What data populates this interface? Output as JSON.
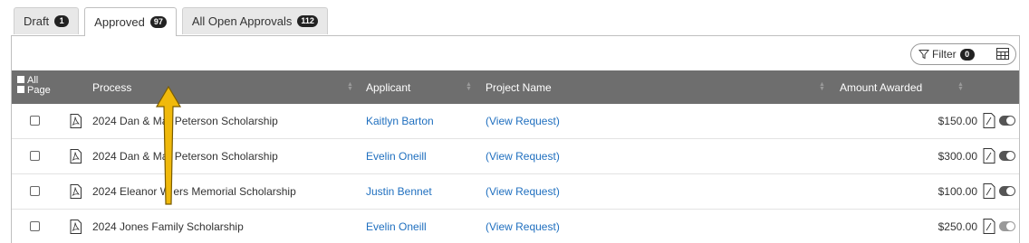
{
  "tabs": [
    {
      "label": "Draft",
      "count": "1"
    },
    {
      "label": "Approved",
      "count": "97"
    },
    {
      "label": "All Open Approvals",
      "count": "112"
    }
  ],
  "toolbar": {
    "filter_label": "Filter",
    "filter_count": "0"
  },
  "table": {
    "header": {
      "all": "All",
      "page": "Page",
      "process": "Process",
      "applicant": "Applicant",
      "project": "Project Name",
      "amount": "Amount Awarded"
    },
    "rows": [
      {
        "process": "2024 Dan & Mar  Peterson Scholarship",
        "applicant": "Kaitlyn Barton",
        "project": "(View Request)",
        "amount": "$150.00",
        "toggle": "on"
      },
      {
        "process": "2024 Dan & Mar  Peterson Scholarship",
        "applicant": "Evelin Oneill",
        "project": "(View Request)",
        "amount": "$300.00",
        "toggle": "on"
      },
      {
        "process": "2024 Eleanor W  ers Memorial Scholarship",
        "applicant": "Justin Bennet",
        "project": "(View Request)",
        "amount": "$100.00",
        "toggle": "on"
      },
      {
        "process": "2024 Jones Family Scholarship",
        "applicant": "Evelin Oneill",
        "project": "(View Request)",
        "amount": "$250.00",
        "toggle": "off"
      }
    ]
  },
  "colors": {
    "header_bg": "#6e6e6e",
    "link": "#1f6fbf",
    "arrow": "#f0b90b"
  }
}
